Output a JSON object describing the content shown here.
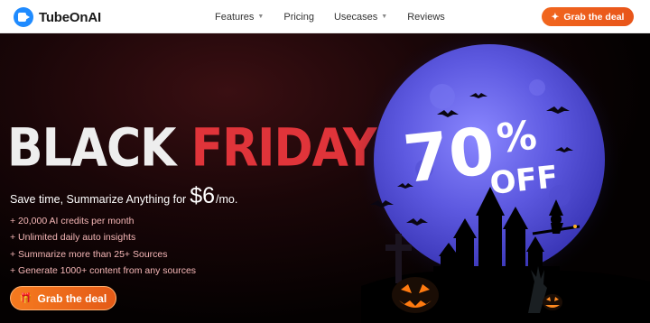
{
  "brand": {
    "name": "TubeOnAI"
  },
  "nav": {
    "items": [
      {
        "label": "Features",
        "dropdown": true
      },
      {
        "label": "Pricing",
        "dropdown": false
      },
      {
        "label": "Usecases",
        "dropdown": true
      },
      {
        "label": "Reviews",
        "dropdown": false
      }
    ],
    "cta_label": "Grab the deal"
  },
  "hero": {
    "headline_word1": "BLACK",
    "headline_word2": "FRIDAY",
    "tagline": "Save time, Summarize Anything for",
    "price": "$6",
    "per": "/mo.",
    "bullets": [
      "+ 20,000 AI credits per month",
      "+ Unlimited daily auto insights",
      "+ Summarize more than 25+ Sources",
      "+ Generate 1000+ content from any sources"
    ],
    "cta_label": "Grab the deal",
    "promo_percent": "70",
    "promo_symbol": "%",
    "promo_off": "OFF"
  },
  "colors": {
    "accent_orange": "#f1661e",
    "headline_red": "#e0343a",
    "moon": "#6a66e8"
  }
}
